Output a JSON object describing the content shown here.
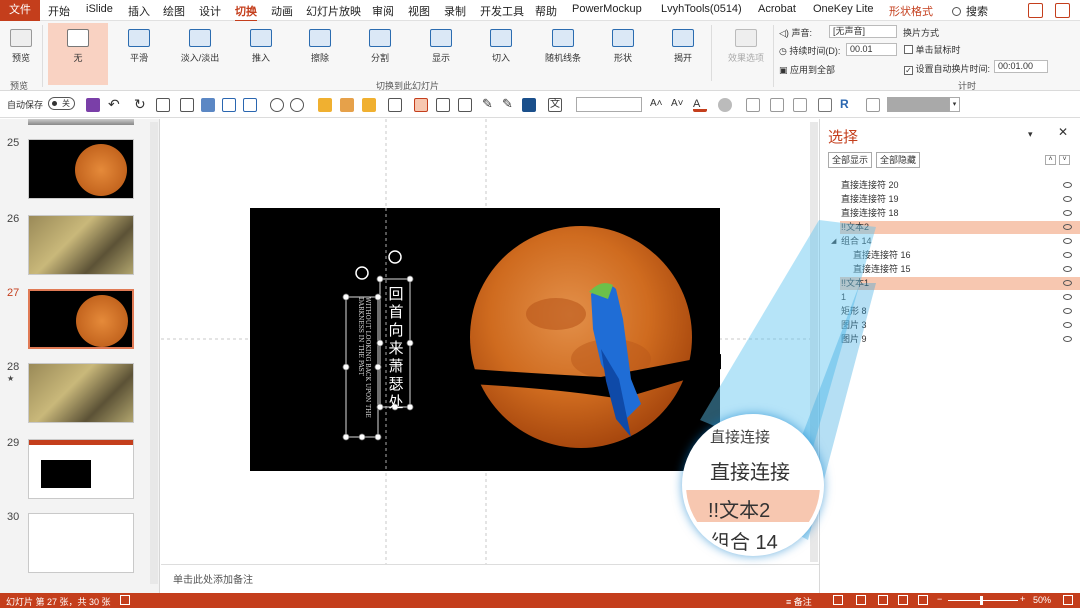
{
  "tabs": [
    "文件",
    "开始",
    "iSlide",
    "插入",
    "绘图",
    "设计",
    "切换",
    "动画",
    "幻灯片放映",
    "审阅",
    "视图",
    "录制",
    "开发工具",
    "帮助",
    "PowerMockup",
    "LvyhTools(0514)",
    "Acrobat",
    "OneKey Lite",
    "形状格式"
  ],
  "search": "搜索",
  "ribbon": {
    "preview": "预览",
    "preview_group": "预览",
    "transitions": [
      "无",
      "平滑",
      "淡入/淡出",
      "推入",
      "擦除",
      "分割",
      "显示",
      "切入",
      "随机线条",
      "形状",
      "揭开"
    ],
    "effect_options": "效果选项",
    "group_label": "切换到此幻灯片",
    "sound_label": "声音:",
    "sound_value": "[无声音]",
    "duration_label": "持续时间(D):",
    "duration_value": "00.01",
    "apply_all": "应用到全部",
    "advance_title": "换片方式",
    "on_click": "单击鼠标时",
    "after_label": "设置自动换片时间:",
    "after_value": "00:01.00",
    "timing_group": "计时"
  },
  "qa": {
    "autosave": "自动保存",
    "autosave_state": "关",
    "text_icon": "文",
    "r_icon": "R"
  },
  "slides": [
    {
      "n": "25",
      "kind": "moon"
    },
    {
      "n": "26",
      "kind": "tree"
    },
    {
      "n": "27",
      "kind": "moon"
    },
    {
      "n": "28",
      "kind": "tree",
      "star": "★"
    },
    {
      "n": "29",
      "kind": "screen"
    },
    {
      "n": "30",
      "kind": "blank"
    }
  ],
  "slide": {
    "cn_text": "回首向来萧瑟处",
    "en_text": "WITHOUT LOOKING BACK UPON THE DARKNESS IN THE PAST"
  },
  "notes_placeholder": "单击此处添加备注",
  "pane": {
    "title": "选择",
    "show_all": "全部显示",
    "hide_all": "全部隐藏",
    "items": [
      "直接连接符 20",
      "直接连接符 19",
      "直接连接符 18",
      "!!文本2",
      "组合 14",
      "直接连接符 16",
      "直接连接符 15",
      "!!文本1",
      "1",
      "矩形 8",
      "图片 3",
      "图片 9"
    ],
    "zoom_items": [
      "直接连接",
      "!!文本2",
      "组合 14",
      "直接"
    ]
  },
  "status": {
    "left": "幻灯片 第 27 张，共 30 张",
    "notes": "备注",
    "zoom": "50%"
  },
  "colors": {
    "accent": "#c43e1c",
    "selection": "#f7c7b0",
    "moon": "#d46a1c"
  }
}
